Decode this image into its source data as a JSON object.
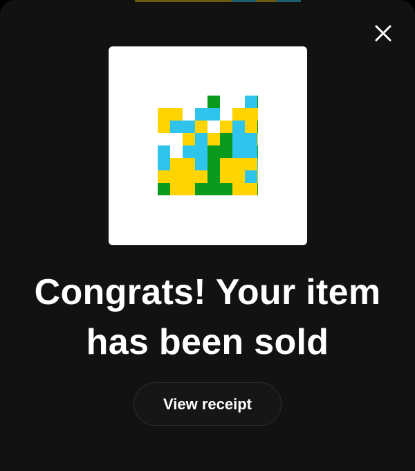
{
  "dialog": {
    "headline_line1": "Congrats! Your item",
    "headline_line2": "has been sold",
    "view_receipt_label": "View receipt",
    "close_icon": "close-icon",
    "artwork_icon": "pixel-art-nft"
  },
  "colors": {
    "sheet_background": "#121212",
    "text": "#ffffff",
    "art_card_background": "#ffffff",
    "art_yellow": "#ffd400",
    "art_cyan": "#2fc4ec",
    "art_green": "#0a9a1e",
    "button_border": "#2e2e2e"
  }
}
